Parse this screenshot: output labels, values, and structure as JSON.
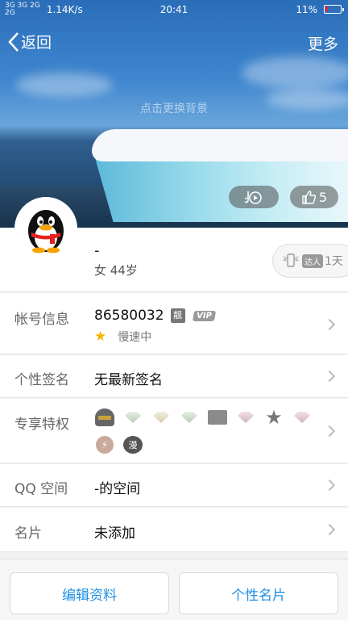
{
  "status_bar": {
    "signal_top": "3G 3G 2G",
    "signal_bottom": "2G",
    "net_speed": "1.14K/s",
    "time": "20:41",
    "battery": "11%"
  },
  "nav": {
    "back_label": "返回",
    "more_label": "更多"
  },
  "cover": {
    "change_background": "点击更换背景",
    "like_count": "5"
  },
  "profile": {
    "nickname": "-",
    "gender_age": "女 44岁",
    "expert_tag": "达人",
    "expert_days": "1天"
  },
  "rows": {
    "account": {
      "label": "帐号信息",
      "qq_number": "86580032",
      "liang_badge": "靓",
      "vip_badge": "VIP",
      "speed_text": "慢速中"
    },
    "signature": {
      "label": "个性签名",
      "value": "无最新签名"
    },
    "privileges": {
      "label": "专享特权",
      "manhua_label": "漫"
    },
    "qzone": {
      "label": "QQ 空间",
      "value": "-的空间"
    },
    "card": {
      "label": "名片",
      "value": "未添加"
    }
  },
  "bottom": {
    "edit_profile": "编辑资料",
    "personal_card": "个性名片"
  },
  "colors": {
    "accent": "#1e90e6",
    "star": "#f5b400"
  }
}
